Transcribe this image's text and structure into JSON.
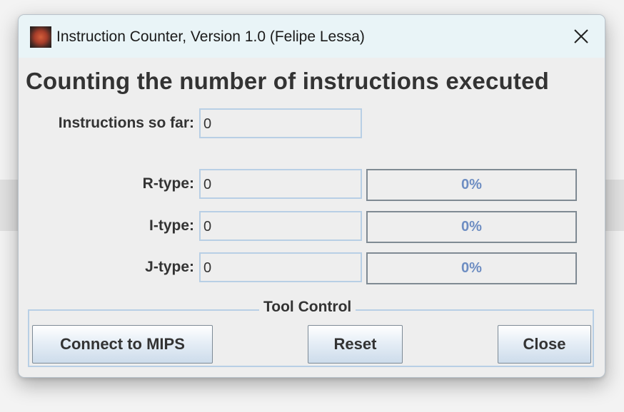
{
  "window": {
    "title": "Instruction Counter, Version 1.0 (Felipe Lessa)"
  },
  "heading": "Counting the number of instructions executed",
  "counter": {
    "label": "Instructions so far:",
    "value": "0"
  },
  "types": [
    {
      "label": "R-type:",
      "value": "0",
      "percent_text": "0%",
      "fraction": 0
    },
    {
      "label": "I-type:",
      "value": "0",
      "percent_text": "0%",
      "fraction": 0
    },
    {
      "label": "J-type:",
      "value": "0",
      "percent_text": "0%",
      "fraction": 0
    }
  ],
  "tool_control": {
    "title": "Tool Control",
    "connect_label": "Connect to MIPS",
    "reset_label": "Reset",
    "close_label": "Close"
  },
  "icons": {
    "app": "mars-app-icon",
    "close": "close-icon"
  }
}
